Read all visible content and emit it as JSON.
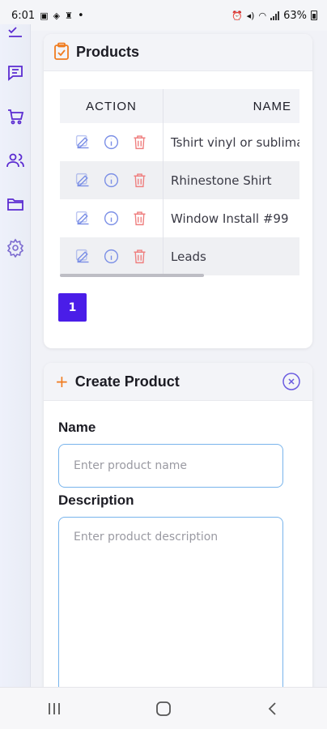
{
  "status_bar": {
    "time": "6:01",
    "battery": "63%",
    "dot": "•"
  },
  "sidebar": {
    "items": [
      {
        "icon": "checklist-icon"
      },
      {
        "icon": "chat-icon"
      },
      {
        "icon": "cart-icon"
      },
      {
        "icon": "users-icon"
      },
      {
        "icon": "folder-icon"
      },
      {
        "icon": "gear-icon"
      }
    ],
    "accent_color": "#5b2bd1"
  },
  "products": {
    "title": "Products",
    "icon": "clipboard-check-icon",
    "columns": [
      "ACTION",
      "NAME"
    ],
    "rows": [
      {
        "name": "Tshirt vinyl or sublimation"
      },
      {
        "name": "Rhinestone Shirt"
      },
      {
        "name": "Window Install #99"
      },
      {
        "name": "Leads"
      }
    ],
    "row_action_icons": [
      "edit-icon",
      "info-icon",
      "trash-icon"
    ],
    "pagination": {
      "current_page": "1"
    },
    "page_color": "#4a1de8"
  },
  "create_product": {
    "title": "Create Product",
    "plus": "+",
    "name_label": "Name",
    "name_placeholder": "Enter product name",
    "description_label": "Description",
    "description_placeholder": "Enter product description"
  },
  "nav_bar": {
    "buttons": [
      "recent-apps-icon",
      "home-icon",
      "back-icon"
    ]
  }
}
